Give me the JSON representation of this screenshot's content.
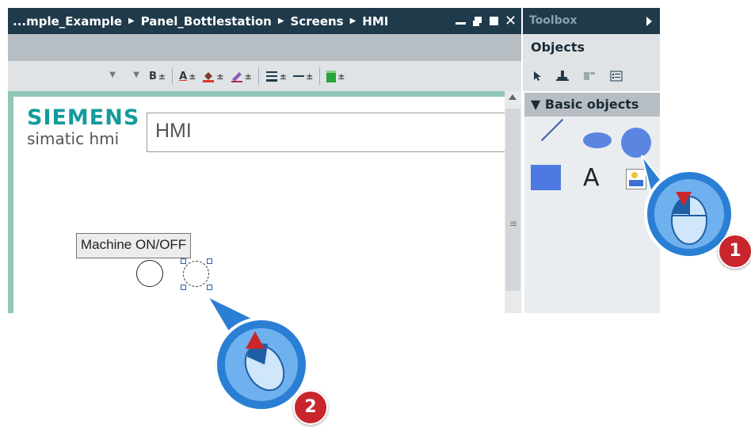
{
  "editor": {
    "breadcrumb": [
      "...mple_Example",
      "Panel_Bottlestation",
      "Screens",
      "HMI"
    ],
    "window_controls": [
      "minimize-icon",
      "float-icon",
      "maximize-icon",
      "close-icon"
    ],
    "close_glyph": "✕"
  },
  "format_toolbar": {
    "bold_label": "B",
    "text_color_label": "A",
    "plus_minus": "±"
  },
  "screen": {
    "logo_brand": "SIEMENS",
    "logo_sub": "simatic hmi",
    "title_field": "HMI",
    "button_label": "Machine ON/OFF"
  },
  "toolbox": {
    "title": "Toolbox",
    "objects_label": "Objects",
    "section_label": "Basic objects",
    "items": [
      "line",
      "ellipse",
      "circle",
      "rectangle",
      "text-field",
      "graphic-view"
    ],
    "text_object_glyph": "A"
  },
  "steps": {
    "step1": "1",
    "step2": "2"
  },
  "colors": {
    "titlebar": "#1f3a4b",
    "accent_teal": "#139b9b",
    "object_blue": "#5a85e0",
    "step_badge": "#c8262c"
  }
}
